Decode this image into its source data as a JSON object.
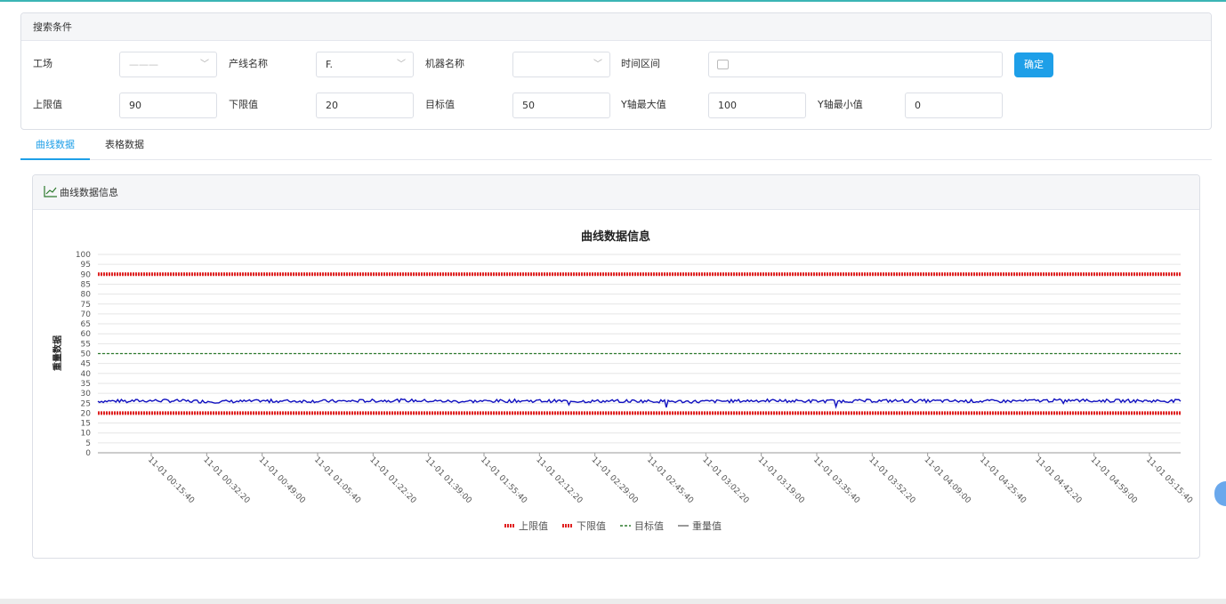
{
  "search": {
    "title": "搜索条件",
    "factory_label": "工场",
    "factory_value": "———",
    "line_label": "产线名称",
    "line_value": "F.",
    "machine_label": "机器名称",
    "machine_value": "",
    "time_label": "时间区间",
    "time_value": "",
    "confirm_label": "确定",
    "upper_label": "上限值",
    "upper_value": "90",
    "lower_label": "下限值",
    "lower_value": "20",
    "target_label": "目标值",
    "target_value": "50",
    "ymax_label": "Y轴最大值",
    "ymax_value": "100",
    "ymin_label": "Y轴最小值",
    "ymin_value": "0"
  },
  "tabs": [
    {
      "label": "曲线数据",
      "active": true
    },
    {
      "label": "表格数据",
      "active": false
    }
  ],
  "card": {
    "title": "曲线数据信息"
  },
  "colors": {
    "accent": "#1e9fe8",
    "upper": "#e02020",
    "lower": "#e02020",
    "target": "#2d7a2d",
    "weight": "#1010c0"
  },
  "chart_data": {
    "type": "line",
    "title": "曲线数据信息",
    "ylabel": "重量数据",
    "xlabel": "",
    "ylim": [
      0,
      100
    ],
    "yticks": [
      0,
      5,
      10,
      15,
      20,
      25,
      30,
      35,
      40,
      45,
      50,
      55,
      60,
      65,
      70,
      75,
      80,
      85,
      90,
      95,
      100
    ],
    "categories": [
      "11-01 00:15:40",
      "11-01 00:32:20",
      "11-01 00:49:00",
      "11-01 01:05:40",
      "11-01 01:22:20",
      "11-01 01:39:00",
      "11-01 01:55:40",
      "11-01 02:12:20",
      "11-01 02:29:00",
      "11-01 02:45:40",
      "11-01 03:02:20",
      "11-01 03:19:00",
      "11-01 03:35:40",
      "11-01 03:52:20",
      "11-01 04:09:00",
      "11-01 04:25:40",
      "11-01 04:42:20",
      "11-01 04:59:00",
      "11-01 05:15:40"
    ],
    "grid": true,
    "legend_position": "bottom",
    "series": [
      {
        "name": "上限值",
        "style": "dotted",
        "values": [
          90,
          90,
          90,
          90,
          90,
          90,
          90,
          90,
          90,
          90,
          90,
          90,
          90,
          90,
          90,
          90,
          90,
          90,
          90
        ]
      },
      {
        "name": "下限值",
        "style": "dotted",
        "values": [
          20,
          20,
          20,
          20,
          20,
          20,
          20,
          20,
          20,
          20,
          20,
          20,
          20,
          20,
          20,
          20,
          20,
          20,
          20
        ]
      },
      {
        "name": "目标值",
        "style": "dashed",
        "values": [
          50,
          50,
          50,
          50,
          50,
          50,
          50,
          50,
          50,
          50,
          50,
          50,
          50,
          50,
          50,
          50,
          50,
          50,
          50
        ]
      },
      {
        "name": "重量值",
        "style": "solid",
        "values": [
          26,
          26.3,
          25.8,
          26.1,
          26,
          26.4,
          25.9,
          26.2,
          26,
          26.1,
          25.8,
          26.3,
          26,
          26.2,
          26.1,
          26,
          26.4,
          26.2,
          26.1
        ]
      }
    ]
  }
}
